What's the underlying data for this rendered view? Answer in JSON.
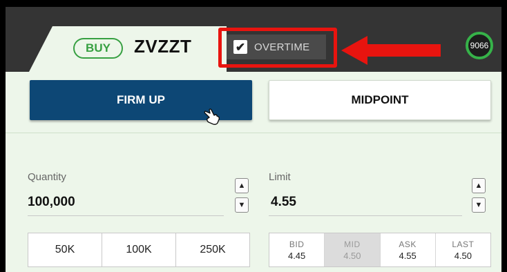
{
  "ticket": {
    "side": "BUY",
    "symbol": "ZVZZT",
    "timer": "9066"
  },
  "overtime": {
    "label": "OVERTIME",
    "checked": true,
    "check_glyph": "✔"
  },
  "actions": {
    "firm_up": "FIRM UP",
    "midpoint": "MIDPOINT"
  },
  "quantity": {
    "label": "Quantity",
    "value": "100,000"
  },
  "limit": {
    "label": "Limit",
    "value": "4.55"
  },
  "stepper": {
    "up": "▲",
    "down": "▼"
  },
  "size_presets": [
    "50K",
    "100K",
    "250K"
  ],
  "prices": [
    {
      "label": "BID",
      "value": "4.45"
    },
    {
      "label": "MID",
      "value": "4.50"
    },
    {
      "label": "ASK",
      "value": "4.55"
    },
    {
      "label": "LAST",
      "value": "4.50"
    }
  ],
  "colors": {
    "buy_green": "#37a042",
    "primary_blue": "#0d4775",
    "highlight_red": "#e8140f",
    "timer_green": "#36b249"
  },
  "icons": {
    "cursor": "hand-pointer-icon",
    "arrow": "arrow-left-icon",
    "check": "checkmark-icon"
  }
}
